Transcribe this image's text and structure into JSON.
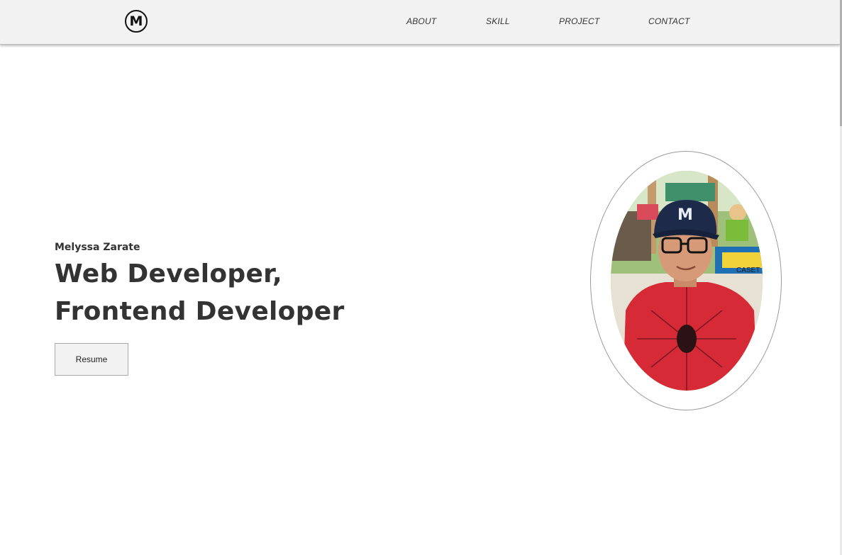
{
  "nav": {
    "logo_letter": "M",
    "links": [
      "ABOUT",
      "SKILL",
      "PROJECT",
      "CONTACT"
    ]
  },
  "hero": {
    "name": "Melyssa Zarate",
    "roles": [
      "Web Developer,",
      "Frontend Developer"
    ],
    "resume_label": "Resume",
    "photo": {
      "cap_letter": "M",
      "sign_text": "CASET"
    }
  },
  "colors": {
    "nav_bg": "#f2f2f2",
    "text": "#333333",
    "button_bg": "#f2f2f2",
    "shirt": "#d62a36",
    "cap": "#1d2a4a"
  }
}
